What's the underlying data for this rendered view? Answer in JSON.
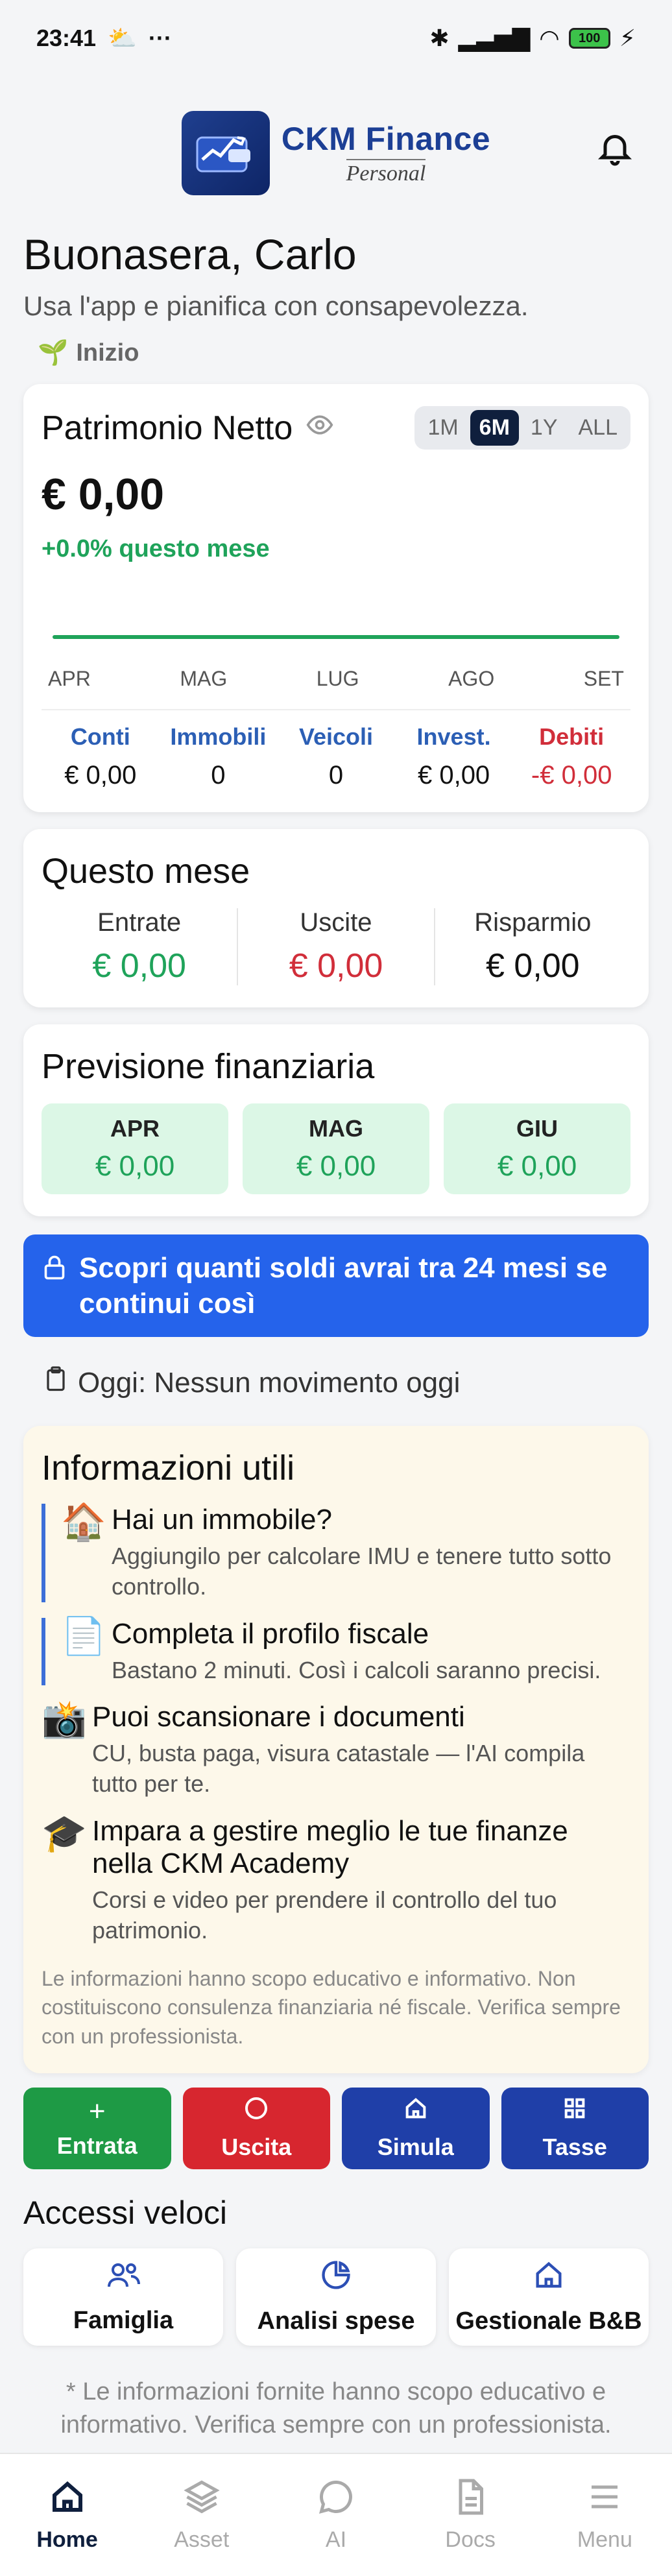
{
  "status": {
    "time": "23:41",
    "battery": "100"
  },
  "app": {
    "brand": "CKM Finance",
    "brand_sub": "Personal"
  },
  "greeting": {
    "title": "Buonasera, Carlo",
    "subtitle": "Usa l'app e pianifica con consapevolezza.",
    "stage": "Inizio"
  },
  "net_worth": {
    "title": "Patrimonio Netto",
    "ranges": [
      "1M",
      "6M",
      "1Y",
      "ALL"
    ],
    "active_range": "6M",
    "value": "€ 0,00",
    "change": "+0.0% questo mese",
    "months": [
      "APR",
      "MAG",
      "LUG",
      "AGO",
      "SET"
    ],
    "categories": [
      {
        "label": "Conti",
        "value": "€ 0,00"
      },
      {
        "label": "Immobili",
        "value": "0"
      },
      {
        "label": "Veicoli",
        "value": "0"
      },
      {
        "label": "Invest.",
        "value": "€ 0,00"
      },
      {
        "label": "Debiti",
        "value": "-€ 0,00"
      }
    ]
  },
  "this_month": {
    "title": "Questo mese",
    "income_label": "Entrate",
    "income_value": "€ 0,00",
    "expense_label": "Uscite",
    "expense_value": "€ 0,00",
    "savings_label": "Risparmio",
    "savings_value": "€ 0,00"
  },
  "forecast": {
    "title": "Previsione finanziaria",
    "items": [
      {
        "month": "APR",
        "value": "€ 0,00"
      },
      {
        "month": "MAG",
        "value": "€ 0,00"
      },
      {
        "month": "GIU",
        "value": "€ 0,00"
      }
    ]
  },
  "cta": {
    "label": "Scopri quanti soldi avrai tra 24 mesi se continui così"
  },
  "today": {
    "label": "Oggi: Nessun movimento oggi"
  },
  "info": {
    "title": "Informazioni utili",
    "tips": [
      {
        "icon": "house-icon",
        "title": "Hai un immobile?",
        "desc": "Aggiungilo per calcolare IMU e tenere tutto sotto controllo."
      },
      {
        "icon": "document-icon",
        "title": "Completa il profilo fiscale",
        "desc": "Bastano 2 minuti. Così i calcoli saranno precisi."
      },
      {
        "icon": "camera-icon",
        "title": "Puoi scansionare i documenti",
        "desc": "CU, busta paga, visura catastale — l'AI compila tutto per te."
      },
      {
        "icon": "graduation-cap-icon",
        "title": "Impara a gestire meglio le tue finanze nella CKM Academy",
        "desc": "Corsi e video per prendere il controllo del tuo patrimonio."
      }
    ],
    "disclaimer": "Le informazioni hanno scopo educativo e informativo. Non costituiscono consulenza finanziaria né fiscale. Verifica sempre con un professionista."
  },
  "actions": {
    "income": "Entrata",
    "expense": "Uscita",
    "simulate": "Simula",
    "taxes": "Tasse"
  },
  "quick_access": {
    "title": "Accessi veloci",
    "family": "Famiglia",
    "analysis": "Analisi spese",
    "bnb": "Gestionale B&B"
  },
  "footnote": "* Le informazioni fornite hanno scopo educativo e informativo. Verifica sempre con un professionista.",
  "nav": {
    "home": "Home",
    "asset": "Asset",
    "ai": "AI",
    "docs": "Docs",
    "menu": "Menu"
  },
  "colors": {
    "primary": "#0f1f3d",
    "accent_blue": "#2563eb",
    "green": "#1fa35a",
    "red": "#d12e3a"
  }
}
